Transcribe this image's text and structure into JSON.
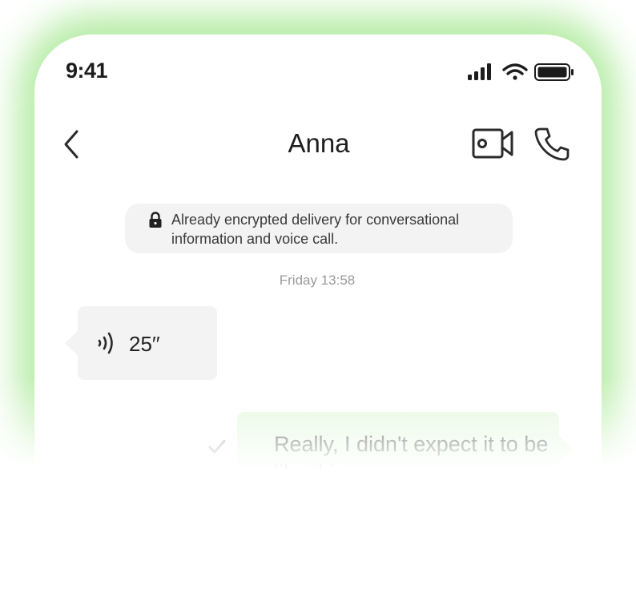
{
  "status_bar": {
    "time": "9:41",
    "icons": [
      "signal-icon",
      "wifi-icon",
      "battery-icon"
    ]
  },
  "header": {
    "contact_name": "Anna",
    "back_icon": "chevron-left-icon",
    "actions": [
      "video-call-icon",
      "phone-call-icon"
    ]
  },
  "notice": {
    "icon": "lock-icon",
    "text": "Already encrypted delivery for conversational information and voice call."
  },
  "conversation": {
    "timestamp": "Friday 13:58",
    "incoming_voice": {
      "icon": "voice-wave-icon",
      "duration": "25′′"
    },
    "outgoing_message": {
      "text": "Really, I didn't expect it to be like this~",
      "status_icon": "check-icon"
    }
  },
  "colors": {
    "accent_glow": "#78dc5a",
    "incoming_bubble": "#f3f3f3",
    "outgoing_bubble": "#e2f8dc",
    "text_primary": "#1f1f1f",
    "text_muted": "#9a9a9a"
  }
}
